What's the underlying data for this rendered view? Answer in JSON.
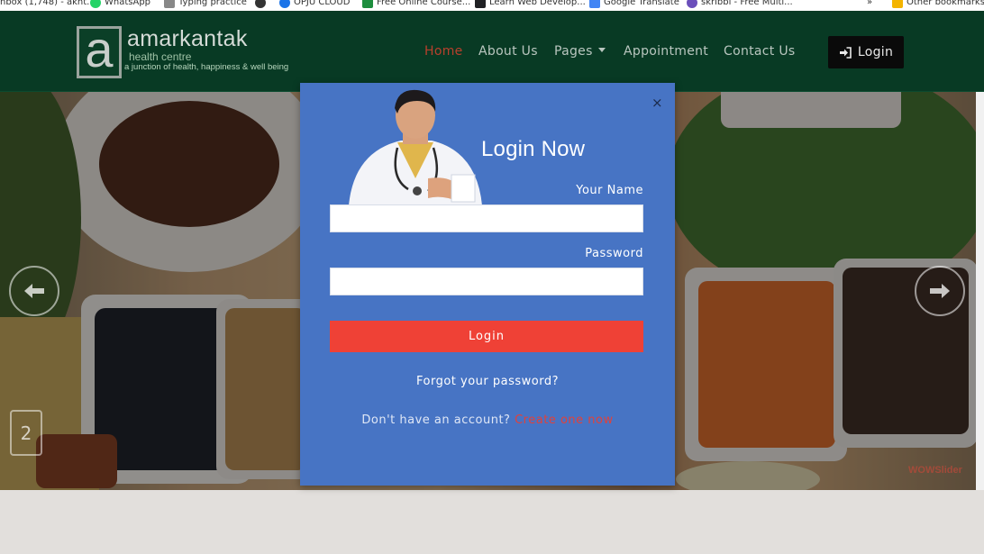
{
  "browser": {
    "bookmarks": [
      {
        "label": "nbox (1,748) - akht...",
        "icon": "mail-icon",
        "color": "#c5221f"
      },
      {
        "label": "WhatsApp",
        "icon": "whatsapp-icon",
        "color": "#25d366"
      },
      {
        "label": "Typing practice",
        "icon": "page-icon",
        "color": "#888888"
      },
      {
        "label": "",
        "icon": "shield-icon",
        "color": "#333333"
      },
      {
        "label": "OPJU CLOUD",
        "icon": "cloud-icon",
        "color": "#1a73e8"
      },
      {
        "label": "Free Online Course...",
        "icon": "course-icon",
        "color": "#1e8e3e"
      },
      {
        "label": "Learn Web Develop...",
        "icon": "learn-icon",
        "color": "#202124"
      },
      {
        "label": "Google Translate",
        "icon": "translate-icon",
        "color": "#4285f4"
      },
      {
        "label": "skribbl - Free Multi...",
        "icon": "game-icon",
        "color": "#6b4fbb"
      },
      {
        "label": "Other bookmarks",
        "icon": "folder-icon",
        "color": "#f4b400"
      }
    ],
    "overflow": "»"
  },
  "site": {
    "logo": {
      "mark": "a",
      "name": "amarkantak",
      "subtitle": "health centre",
      "tagline": "a junction of health, happiness & well being"
    },
    "nav": [
      {
        "label": "Home",
        "active": true
      },
      {
        "label": "About Us",
        "active": false
      },
      {
        "label": "Pages",
        "active": false,
        "dropdown": true
      },
      {
        "label": "Appointment",
        "active": false
      },
      {
        "label": "Contact Us",
        "active": false
      }
    ],
    "login_button": {
      "label": "Login",
      "icon": "sign-in-icon"
    }
  },
  "slider": {
    "prev_icon": "arrow-left-icon",
    "next_icon": "arrow-right-icon",
    "slide_number": "2",
    "watermark": "WOWSlider"
  },
  "modal": {
    "close": "×",
    "title": "Login Now",
    "name_label": "Your Name",
    "name_value": "",
    "password_label": "Password",
    "password_value": "",
    "submit_label": "Login",
    "forgot_link": "Forgot your password?",
    "signup_text": "Don't have an account?",
    "signup_link": "Create one now"
  },
  "colors": {
    "navbar": "#083a24",
    "modal": "#4774c4",
    "submit": "#ef4136",
    "active_nav": "#b8402d",
    "signup_link": "#e2413a"
  }
}
